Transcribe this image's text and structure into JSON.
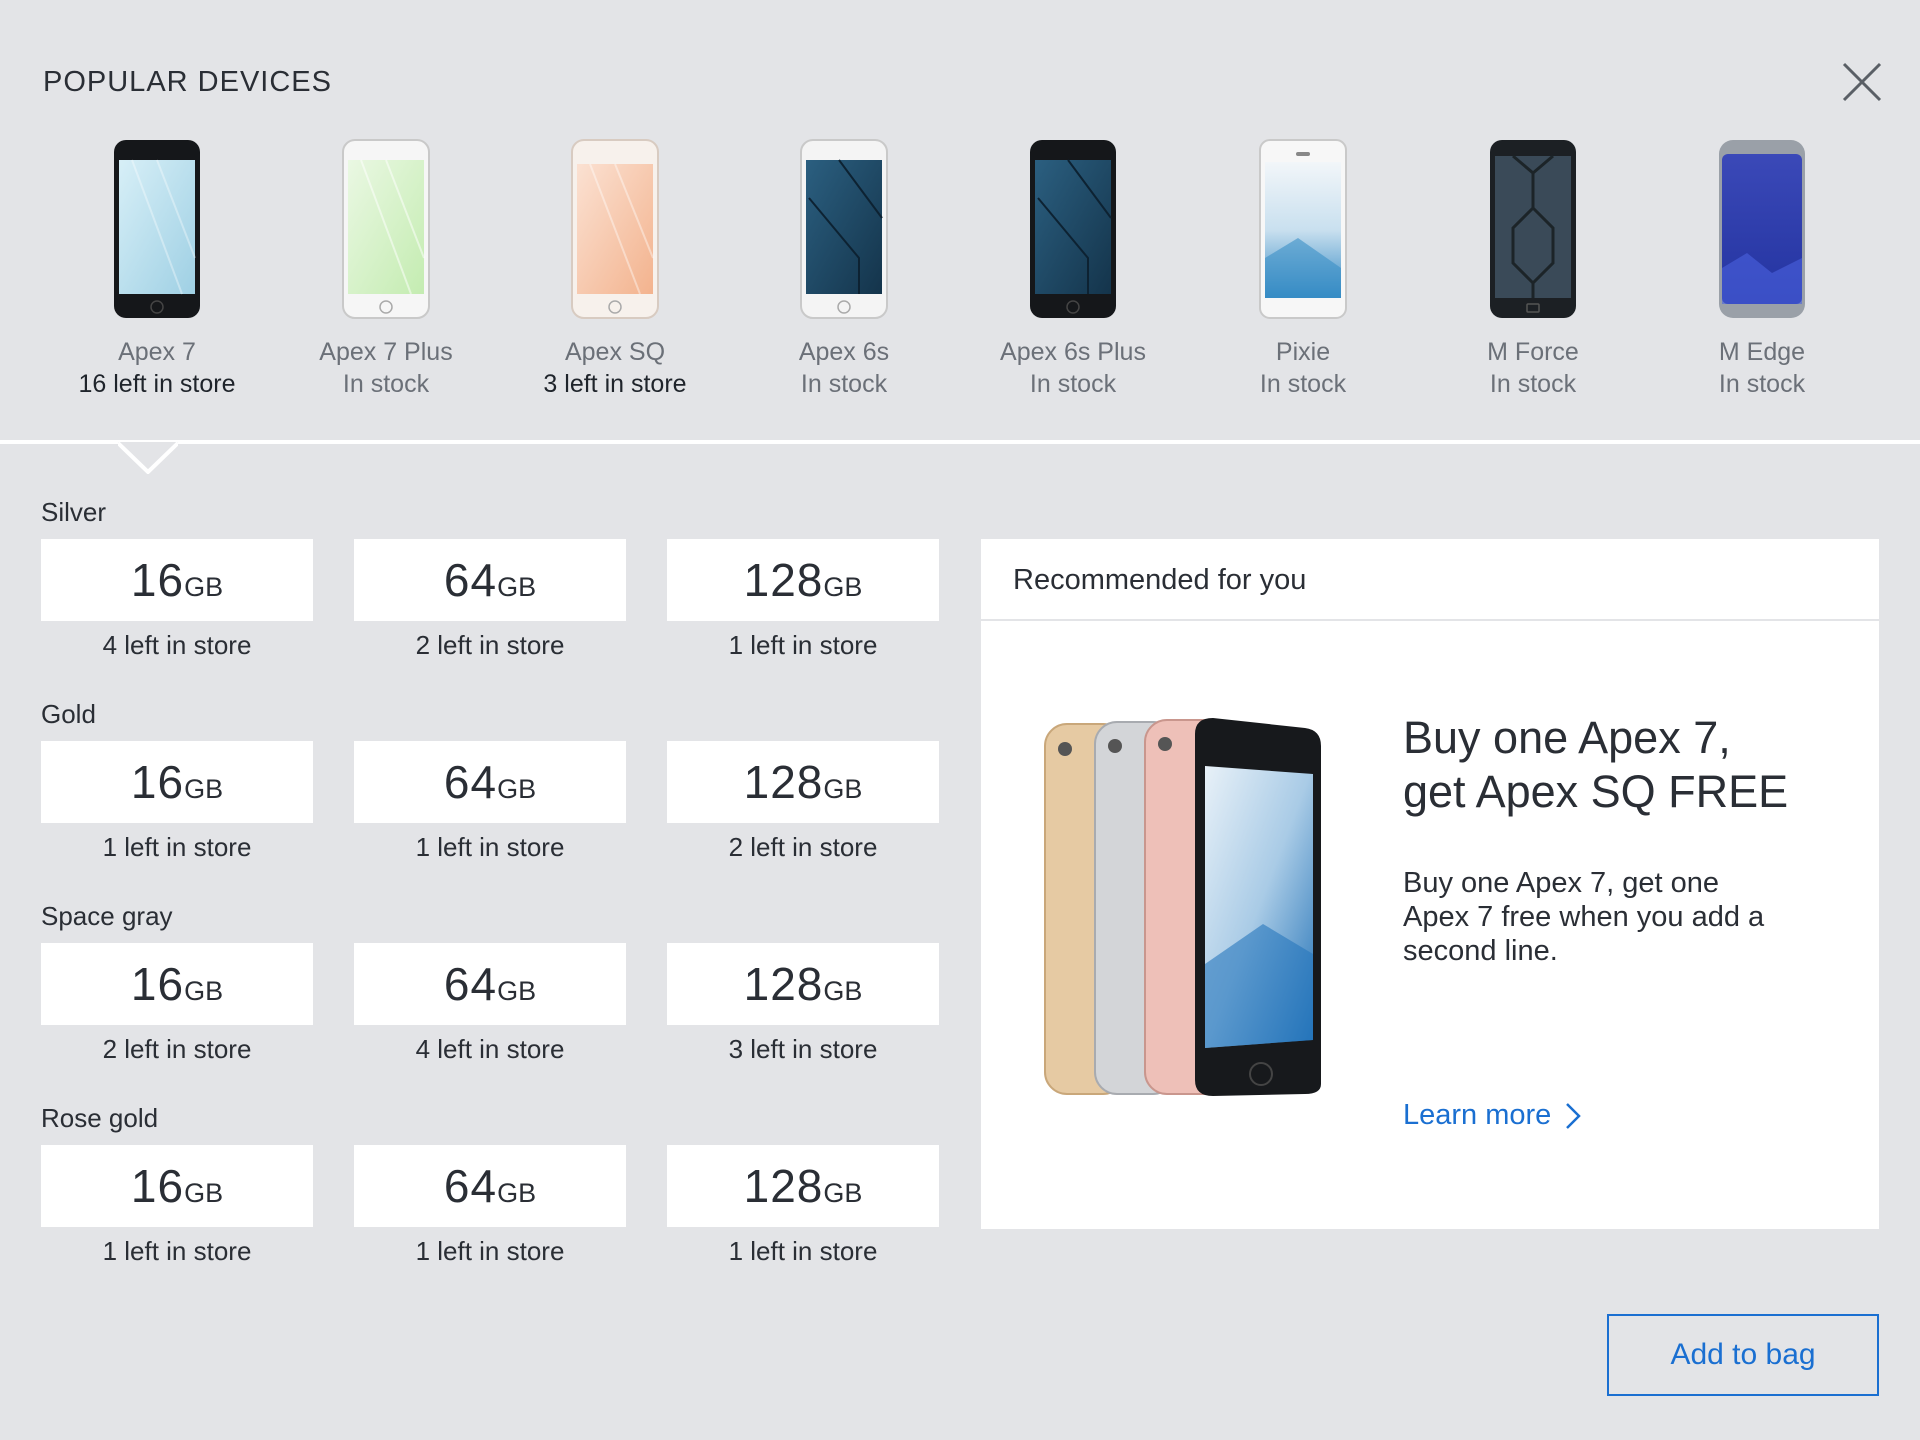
{
  "header": {
    "title": "POPULAR DEVICES"
  },
  "devices": [
    {
      "name": "Apex 7",
      "stock": "16 left in store"
    },
    {
      "name": "Apex 7 Plus",
      "stock": "In stock"
    },
    {
      "name": "Apex SQ",
      "stock": "3 left in store"
    },
    {
      "name": "Apex 6s",
      "stock": "In stock"
    },
    {
      "name": "Apex 6s Plus",
      "stock": "In stock"
    },
    {
      "name": "Pixie",
      "stock": "In stock"
    },
    {
      "name": "M Force",
      "stock": "In stock"
    },
    {
      "name": "M Edge",
      "stock": "In stock"
    }
  ],
  "unit": "GB",
  "colors": [
    {
      "label": "Silver",
      "options": [
        {
          "size": "16",
          "stock": "4 left in store"
        },
        {
          "size": "64",
          "stock": "2 left in store"
        },
        {
          "size": "128",
          "stock": "1 left in store"
        }
      ]
    },
    {
      "label": "Gold",
      "options": [
        {
          "size": "16",
          "stock": "1 left in store"
        },
        {
          "size": "64",
          "stock": "1 left in store"
        },
        {
          "size": "128",
          "stock": "2 left in store"
        }
      ]
    },
    {
      "label": "Space gray",
      "options": [
        {
          "size": "16",
          "stock": "2 left in store"
        },
        {
          "size": "64",
          "stock": "4 left in store"
        },
        {
          "size": "128",
          "stock": "3 left in store"
        }
      ]
    },
    {
      "label": "Rose gold",
      "options": [
        {
          "size": "16",
          "stock": "1 left in store"
        },
        {
          "size": "64",
          "stock": "1 left in store"
        },
        {
          "size": "128",
          "stock": "1 left in store"
        }
      ]
    }
  ],
  "recommended": {
    "heading": "Recommended for you",
    "promo_title_line1": "Buy one Apex 7,",
    "promo_title_line2": "get Apex SQ FREE",
    "promo_text": "Buy one Apex 7, get one Apex 7 free when you add a second line.",
    "learn_more": "Learn more"
  },
  "actions": {
    "add_to_bag": "Add to bag"
  },
  "theme": {
    "accent": "#1a6fd1",
    "background": "#e3e4e7",
    "card": "#ffffff"
  },
  "icons": {
    "close": "close-icon",
    "learn_more": "chevron-right-icon"
  }
}
